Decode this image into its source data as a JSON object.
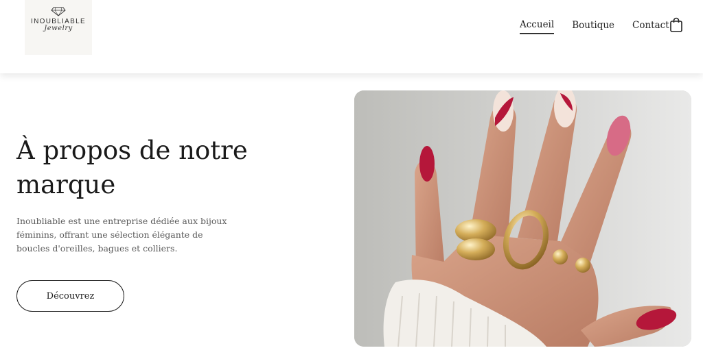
{
  "brand": {
    "name": "INOUBLIABLE",
    "tagline": "Jewelry"
  },
  "nav": {
    "items": [
      {
        "label": "Accueil",
        "active": true
      },
      {
        "label": "Boutique",
        "active": false
      },
      {
        "label": "Contact",
        "active": false
      }
    ],
    "cart_icon": "shopping-bag-icon"
  },
  "hero": {
    "title": "À propos de notre marque",
    "description": "Inoubliable est une entreprise dédiée aux bijoux féminins, offrant une sélection élégante de boucles d'oreilles, bagues et colliers.",
    "cta_label": "Découvrez"
  },
  "colors": {
    "text": "#1f1f1f",
    "muted_text": "#5a5a5a",
    "background": "#ffffff",
    "nail_red": "#b5173a",
    "nail_pink": "#d76b86",
    "gold": "#c9a14a"
  }
}
